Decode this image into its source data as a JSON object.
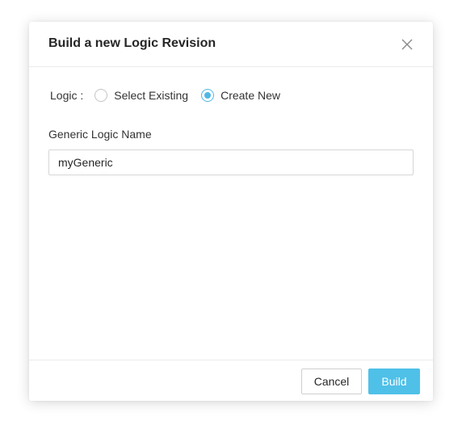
{
  "dialog": {
    "title": "Build a new Logic Revision",
    "close_icon": "close-icon"
  },
  "logic": {
    "label": "Logic :",
    "options": [
      {
        "label": "Select Existing",
        "selected": false
      },
      {
        "label": "Create New",
        "selected": true
      }
    ]
  },
  "generic_name": {
    "label": "Generic Logic Name",
    "value": "myGeneric"
  },
  "footer": {
    "cancel_label": "Cancel",
    "build_label": "Build"
  },
  "colors": {
    "accent": "#4fc0e8",
    "radio_checked": "#4fb8e5"
  }
}
